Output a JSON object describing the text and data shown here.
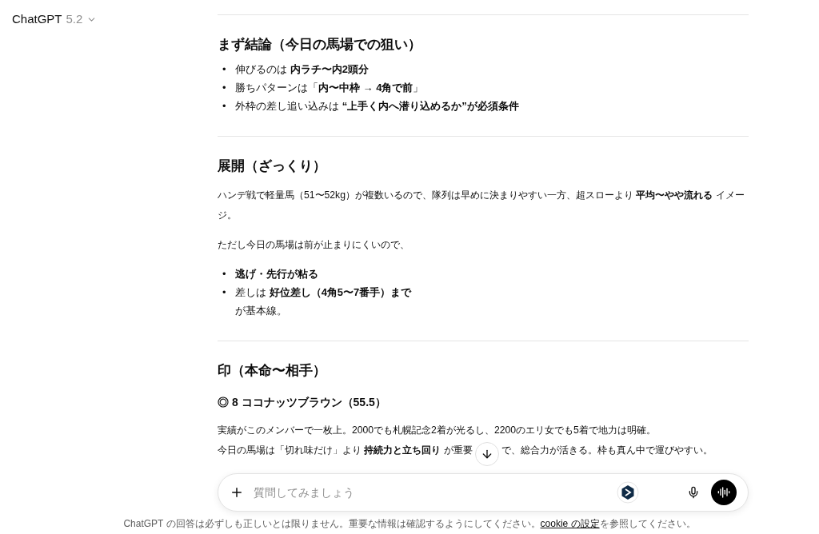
{
  "header": {
    "title": "ChatGPT",
    "version": "5.2"
  },
  "sections": [
    {
      "heading": "まず結論（今日の馬場での狙い）",
      "blocks": [
        {
          "kind": "list",
          "items": [
            {
              "marker": "•",
              "text": "伸びるのは **内ラチ〜内2頭分**"
            },
            {
              "marker": "•",
              "text": "勝ちパターンは「**内〜中枠 → 4角で前**」"
            },
            {
              "marker": "•",
              "text": "外枠の差し追い込みは **“上手く内へ潜り込めるか”が必須条件**"
            }
          ]
        }
      ]
    },
    {
      "heading": "展開（ざっくり）",
      "blocks": [
        {
          "kind": "paragraph",
          "lines": [
            [
              "ハンデ戦で軽量馬（51〜52kg）が複数いるので、隊列は早めに決まりやすい一方、超スローより **平均〜やや流れる** イメージ。"
            ]
          ]
        },
        {
          "kind": "paragraph",
          "lines": [
            [
              "ただし今日の馬場は前が止まりにくいので、"
            ]
          ]
        },
        {
          "kind": "list",
          "items": [
            {
              "marker": "•",
              "text": "**逃げ・先行が粘る**"
            },
            {
              "marker": "•",
              "text": "差しは **好位差し（4角5〜7番手）まで**",
              "continuation": "が基本線。"
            }
          ]
        }
      ]
    },
    {
      "heading": "印（本命〜相手）",
      "blocks": [
        {
          "kind": "subheading",
          "text": "◎ 8 ココナッツブラウン（55.5）"
        },
        {
          "kind": "paragraph",
          "lines": [
            [
              "実績がこのメンバーで一枚上。2000でも札幌記念2着が光るし、2200のエリ女でも5着で地力は明確。"
            ],
            [
              "今日の馬場は「切れ味だけ」より **持続力と立ち回り** が重要",
              "で、総合力が活きる。枠も真ん中で運びやすい。"
            ]
          ]
        }
      ]
    }
  ],
  "composer": {
    "placeholder": "質問してみましょう"
  },
  "footer": {
    "before": "ChatGPT の回答は必ずしも正しいとは限りません。重要な情報は確認するようにしてください。",
    "link": "cookie の設定",
    "after": "を参照してください。"
  }
}
